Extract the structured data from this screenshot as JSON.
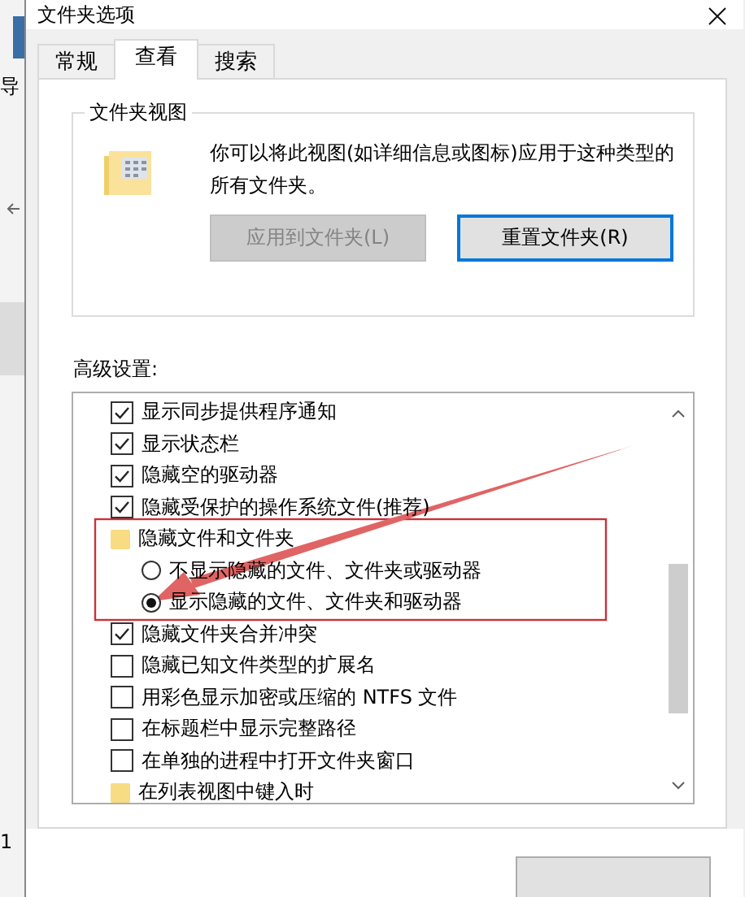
{
  "background_window": {
    "fragments": [
      "导",
      "1"
    ]
  },
  "window": {
    "title": "文件夹选项"
  },
  "tabs": [
    {
      "label": "常规",
      "selected": false
    },
    {
      "label": "查看",
      "selected": true
    },
    {
      "label": "搜索",
      "selected": false
    }
  ],
  "folder_views": {
    "title": "文件夹视图",
    "description": "你可以将此视图(如详细信息或图标)应用于这种类型的所有文件夹。",
    "buttons": [
      {
        "label": "应用到文件夹(L)",
        "disabled": true
      },
      {
        "label": "重置文件夹(R)",
        "disabled": false
      }
    ]
  },
  "advanced": {
    "label": "高级设置:",
    "items": [
      {
        "kind": "checkbox",
        "label": "显示同步提供程序通知",
        "checked": true
      },
      {
        "kind": "checkbox",
        "label": "显示状态栏",
        "checked": true
      },
      {
        "kind": "checkbox",
        "label": "隐藏空的驱动器",
        "checked": true
      },
      {
        "kind": "checkbox",
        "label": "隐藏受保护的操作系统文件(推荐)",
        "checked": true
      },
      {
        "kind": "folder",
        "label": "隐藏文件和文件夹",
        "children": [
          {
            "kind": "radio",
            "label": "不显示隐藏的文件、文件夹或驱动器",
            "selected": false
          },
          {
            "kind": "radio",
            "label": "显示隐藏的文件、文件夹和驱动器",
            "selected": true
          }
        ]
      },
      {
        "kind": "checkbox",
        "label": "隐藏文件夹合并冲突",
        "checked": true
      },
      {
        "kind": "checkbox",
        "label": "隐藏已知文件类型的扩展名",
        "checked": false
      },
      {
        "kind": "checkbox",
        "label": "用彩色显示加密或压缩的 NTFS 文件",
        "checked": false
      },
      {
        "kind": "checkbox",
        "label": "在标题栏中显示完整路径",
        "checked": false
      },
      {
        "kind": "checkbox",
        "label": "在单独的进程中打开文件夹窗口",
        "checked": false
      },
      {
        "kind": "folder",
        "label": "在列表视图中键入时"
      }
    ]
  }
}
